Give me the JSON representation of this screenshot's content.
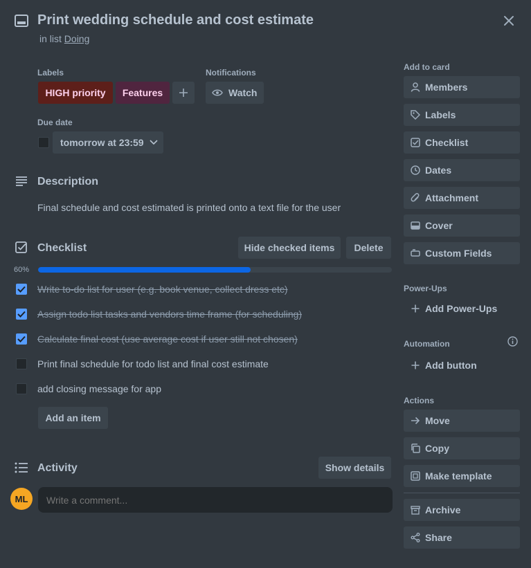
{
  "card": {
    "title": "Print wedding schedule and cost estimate",
    "in_list_prefix": "in list",
    "list_name": "Doing"
  },
  "labels": {
    "heading": "Labels",
    "items": [
      {
        "text": "HIGH priority",
        "bg": "#5d1f1a",
        "color": "#fdd0ec"
      },
      {
        "text": "Features",
        "bg": "#50253f",
        "color": "#fdd0ec"
      }
    ]
  },
  "notifications": {
    "heading": "Notifications",
    "watch_label": "Watch"
  },
  "due": {
    "heading": "Due date",
    "value": "tomorrow at 23:59"
  },
  "description": {
    "heading": "Description",
    "text": "Final schedule and cost estimated is printed onto a text file for the user"
  },
  "checklist": {
    "heading": "Checklist",
    "hide_label": "Hide checked items",
    "delete_label": "Delete",
    "progress_text": "60%",
    "progress": 0.6,
    "progress_color": "#0c66e4",
    "items": [
      {
        "text": "Write to-do list for user (e.g. book venue, collect dress etc)",
        "checked": true
      },
      {
        "text": "Assign todo list tasks and vendors time frame (for scheduling)",
        "checked": true
      },
      {
        "text": "Calculate final cost (use average cost if user still not chosen)",
        "checked": true
      },
      {
        "text": "Print final schedule for todo list and final cost estimate",
        "checked": false
      },
      {
        "text": "add closing message for app",
        "checked": false
      }
    ],
    "add_item_label": "Add an item"
  },
  "activity": {
    "heading": "Activity",
    "show_details_label": "Show details",
    "avatar_initials": "ML",
    "avatar_color": "#f5a623",
    "comment_placeholder": "Write a comment..."
  },
  "sidebar": {
    "add_to_card_heading": "Add to card",
    "add_to_card": [
      {
        "label": "Members",
        "icon": "person-icon"
      },
      {
        "label": "Labels",
        "icon": "tag-icon"
      },
      {
        "label": "Checklist",
        "icon": "checkbox-icon"
      },
      {
        "label": "Dates",
        "icon": "clock-icon"
      },
      {
        "label": "Attachment",
        "icon": "paperclip-icon"
      },
      {
        "label": "Cover",
        "icon": "card-cover-icon"
      },
      {
        "label": "Custom Fields",
        "icon": "custom-fields-icon"
      }
    ],
    "powerups_heading": "Power-Ups",
    "add_powerups_label": "Add Power-Ups",
    "automation_heading": "Automation",
    "add_button_label": "Add button",
    "actions_heading": "Actions",
    "actions": [
      {
        "label": "Move",
        "icon": "arrow-right-icon"
      },
      {
        "label": "Copy",
        "icon": "copy-icon"
      },
      {
        "label": "Make template",
        "icon": "template-icon"
      },
      {
        "label": "Archive",
        "icon": "archive-icon"
      },
      {
        "label": "Share",
        "icon": "share-icon"
      }
    ]
  }
}
